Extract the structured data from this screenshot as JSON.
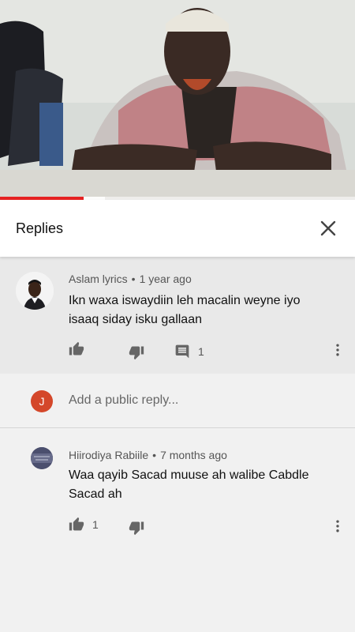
{
  "panel": {
    "title": "Replies"
  },
  "parent_comment": {
    "author": "Aslam lyrics",
    "time": "1 year ago",
    "text_line1": "Ikn waxa iswaydiin leh macalin weyne iyo",
    "text_line2": "isaaq siday isku gallaan",
    "like_count": "",
    "reply_count": "1"
  },
  "reply_input": {
    "avatar_initial": "J",
    "placeholder": "Add a public reply..."
  },
  "reply_comment": {
    "author": "Hiirodiya Rabiile",
    "time": "7 months ago",
    "text_line1": "Waa qayib Sacad muuse ah walibe Cabdle",
    "text_line2": "Sacad ah",
    "like_count": "1"
  },
  "meta_separator": "•",
  "video": {
    "progress_played": 0.235,
    "progress_buffered": 0.295
  },
  "colors": {
    "progress": "#e52222",
    "avatar_initial_bg": "#d4472a"
  }
}
